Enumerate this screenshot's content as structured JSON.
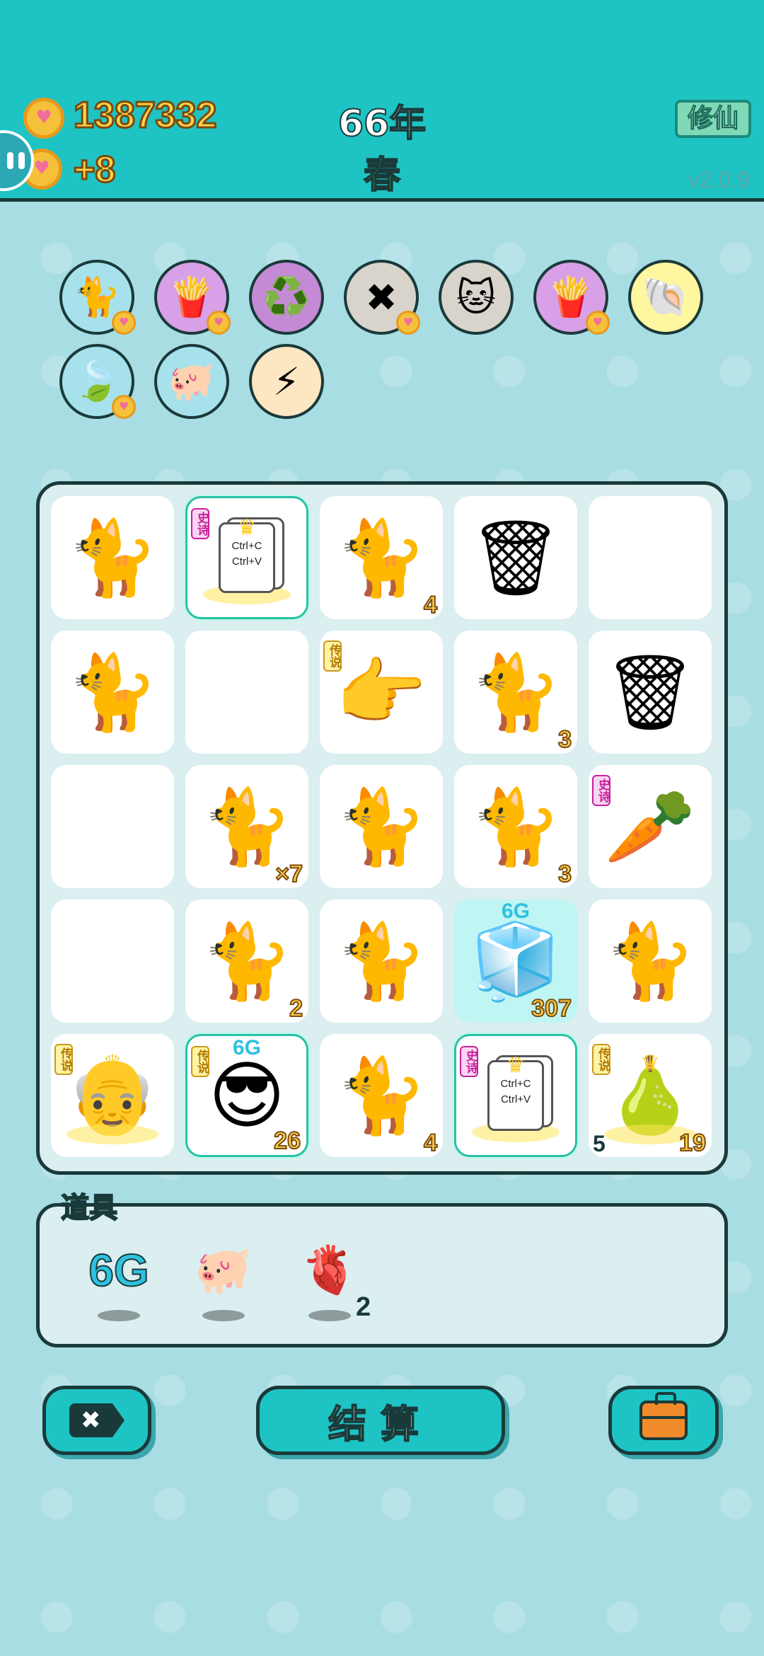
{
  "header": {
    "coins": "1387332",
    "coin_delta": "+8",
    "year": "66年",
    "season": "春",
    "cultivate_button": "修仙",
    "version": "v2.0.9"
  },
  "owned_items": [
    {
      "icon": "cat-icon",
      "glyph": "🐈",
      "color": "#a7e2ec",
      "heart": true
    },
    {
      "icon": "fries-icon",
      "glyph": "🍟",
      "color": "#d8a0e6",
      "heart": true
    },
    {
      "icon": "recycle-icon",
      "glyph": "♻️",
      "color": "#c58ad6",
      "heart": false
    },
    {
      "icon": "delete-tag-icon",
      "glyph": "✖",
      "color": "#d8d4cc",
      "heart": true
    },
    {
      "icon": "two-cats-icon",
      "glyph": "🐱",
      "color": "#d8d4cc",
      "heart": false
    },
    {
      "icon": "fries-icon",
      "glyph": "🍟",
      "color": "#d8a0e6",
      "heart": true
    },
    {
      "icon": "shell-icon",
      "glyph": "🐚",
      "color": "#fff7a0",
      "heart": false
    },
    {
      "icon": "leaf-icon",
      "glyph": "🍃",
      "color": "#a7e2ec",
      "heart": true
    },
    {
      "icon": "piggy-bank-icon",
      "glyph": "🐖",
      "color": "#a7e2ec",
      "heart": false
    },
    {
      "icon": "lightning-icon",
      "glyph": "⚡",
      "color": "#fde6c2",
      "heart": false
    }
  ],
  "board": {
    "cells": [
      {
        "item": "cat-icon",
        "glyph": "🐈",
        "count": "",
        "tag": ""
      },
      {
        "item": "ctrl-c-ctrl-v-card-icon",
        "glyph": "card",
        "count": "",
        "tag": "史诗",
        "tag_kind": "epic",
        "crown": true,
        "outlined": true,
        "card_lines": [
          "Ctrl+C",
          "Ctrl+V"
        ]
      },
      {
        "item": "cat-icon",
        "glyph": "🐈",
        "count": "4",
        "tag": ""
      },
      {
        "item": "garbage-bag-icon",
        "glyph": "🗑",
        "count": "",
        "tag": ""
      },
      {
        "item": "empty",
        "glyph": "",
        "count": "",
        "tag": ""
      },
      {
        "item": "cat-icon",
        "glyph": "🐈",
        "count": "",
        "tag": ""
      },
      {
        "item": "empty",
        "glyph": "",
        "count": "",
        "tag": ""
      },
      {
        "item": "pointing-hand-icon",
        "glyph": "👉",
        "count": "",
        "tag": "传说",
        "tag_kind": "legend"
      },
      {
        "item": "cat-icon",
        "glyph": "🐈",
        "count": "3",
        "tag": ""
      },
      {
        "item": "garbage-bag-icon",
        "glyph": "🗑",
        "count": "",
        "tag": ""
      },
      {
        "item": "empty",
        "glyph": "",
        "count": "",
        "tag": ""
      },
      {
        "item": "cat-icon",
        "glyph": "🐈",
        "count": "×7",
        "tag": ""
      },
      {
        "item": "cat-icon",
        "glyph": "🐈",
        "count": "",
        "tag": ""
      },
      {
        "item": "cat-icon",
        "glyph": "🐈",
        "count": "3",
        "tag": ""
      },
      {
        "item": "carrot-icon",
        "glyph": "🥕",
        "count": "",
        "tag": "史诗",
        "tag_kind": "epic"
      },
      {
        "item": "empty",
        "glyph": "",
        "count": "",
        "tag": ""
      },
      {
        "item": "cat-icon",
        "glyph": "🐈",
        "count": "2",
        "tag": ""
      },
      {
        "item": "cat-icon",
        "glyph": "🐈",
        "count": "",
        "tag": ""
      },
      {
        "item": "fridge-icon",
        "glyph": "🧊",
        "count": "307",
        "tag": "",
        "teal": true,
        "sixg": true
      },
      {
        "item": "cat-icon",
        "glyph": "🐈",
        "count": "",
        "tag": ""
      },
      {
        "item": "old-man-icon",
        "glyph": "👴",
        "count": "",
        "tag": "传说",
        "tag_kind": "legend",
        "crown": true
      },
      {
        "item": "sunglasses-man-icon",
        "glyph": "😎",
        "count": "26",
        "tag": "传说",
        "tag_kind": "legend",
        "outlined": true,
        "sixg": true
      },
      {
        "item": "cat-icon",
        "glyph": "🐈",
        "count": "4",
        "tag": ""
      },
      {
        "item": "ctrl-c-ctrl-v-card-icon",
        "glyph": "card",
        "count": "",
        "tag": "史诗",
        "tag_kind": "epic",
        "crown": true,
        "outlined": true,
        "card_lines": [
          "Ctrl+C",
          "Ctrl+V"
        ]
      },
      {
        "item": "pear-icon",
        "glyph": "🍐",
        "count": "19",
        "count_left": "5",
        "tag": "传说",
        "tag_kind": "legend",
        "crown": true
      }
    ],
    "sixg_text": "6G"
  },
  "props": {
    "label": "道具",
    "items": [
      {
        "icon": "6g-icon",
        "text": "6G"
      },
      {
        "icon": "piggy-bank-icon",
        "glyph": "🐖"
      },
      {
        "icon": "liver-icon",
        "glyph": "🫀"
      }
    ],
    "liver_count": "2"
  },
  "buttons": {
    "settle": "结算",
    "delete": "✖"
  },
  "colors": {
    "header": "#1ec4c4",
    "background": "#a8dde3",
    "outline": "#1a3a3a",
    "coin": "#f5c13a",
    "count": "#ffd34a"
  }
}
